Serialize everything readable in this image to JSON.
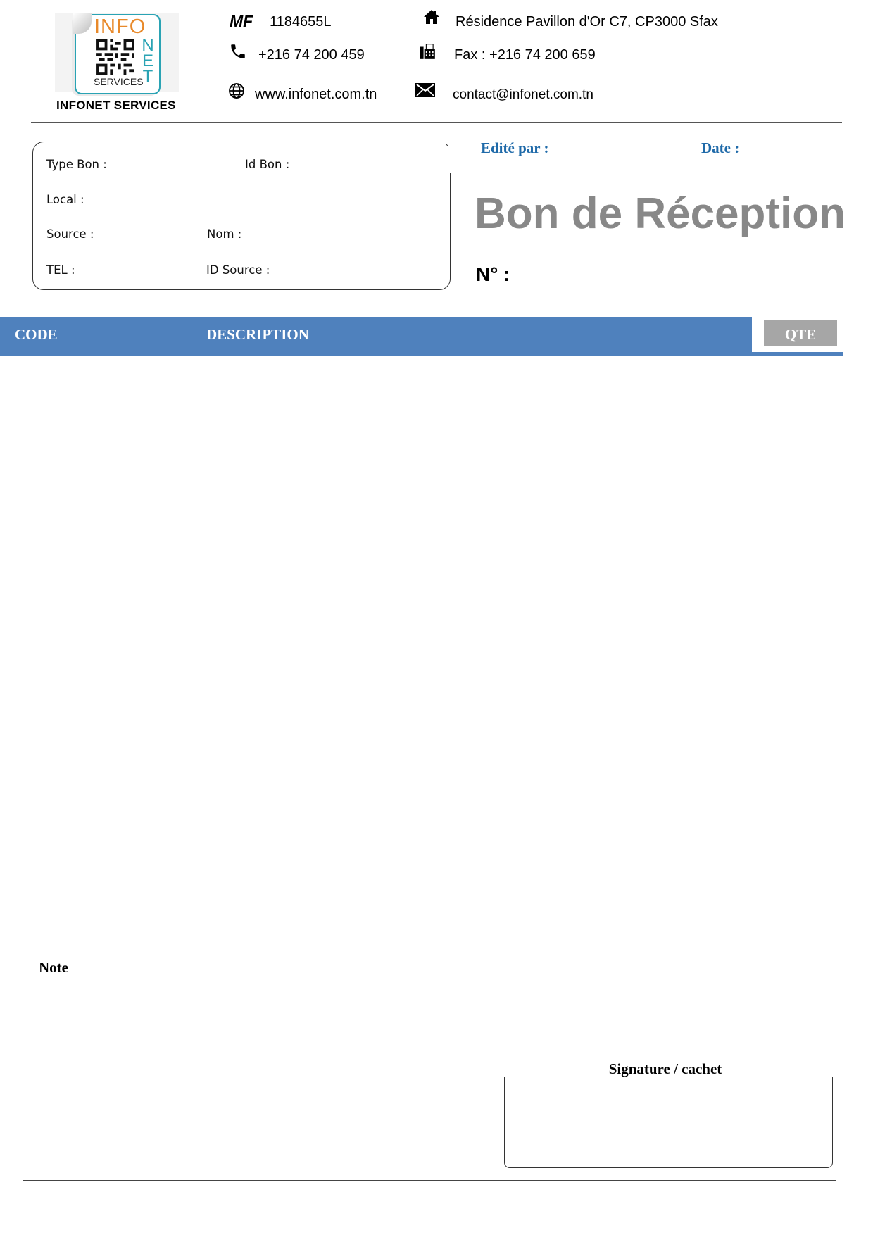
{
  "company": {
    "logo_text_info": "INFO",
    "logo_text_net": "NET",
    "logo_text_services": "SERVICES",
    "name": "INFONET SERVICES"
  },
  "contact": {
    "mf_label": "MF",
    "mf_value": "1184655L",
    "address": "Résidence Pavillon d'Or C7, CP3000 Sfax",
    "phone": "+216 74 200 459",
    "fax": "Fax : +216 74 200 659",
    "website": "www.infonet.com.tn",
    "email": "contact@infonet.com.tn",
    "icons": [
      "home-icon",
      "phone-icon",
      "fax-icon",
      "globe-icon",
      "envelope-icon"
    ]
  },
  "info_box": {
    "type_bon": "Type Bon :",
    "id_bon": "Id Bon :",
    "local": "Local :",
    "source": "Source :",
    "nom": "Nom :",
    "tel": "TEL :",
    "id_source": "ID Source :"
  },
  "meta": {
    "edite_par": "Edité par :",
    "date": "Date :"
  },
  "document": {
    "title": "Bon de Réception",
    "number_label": "N° :"
  },
  "table": {
    "columns": [
      "CODE",
      "DESCRIPTION",
      "QTE"
    ],
    "rows": []
  },
  "footer": {
    "note_label": "Note",
    "signature_label": "Signature / cachet"
  },
  "colors": {
    "header_blue": "#4f81bd",
    "label_blue": "#1f6aa9",
    "title_gray": "#888888",
    "qte_gray": "#a6a6a6",
    "logo_orange": "#e8892a",
    "logo_teal": "#2aa3b4"
  }
}
